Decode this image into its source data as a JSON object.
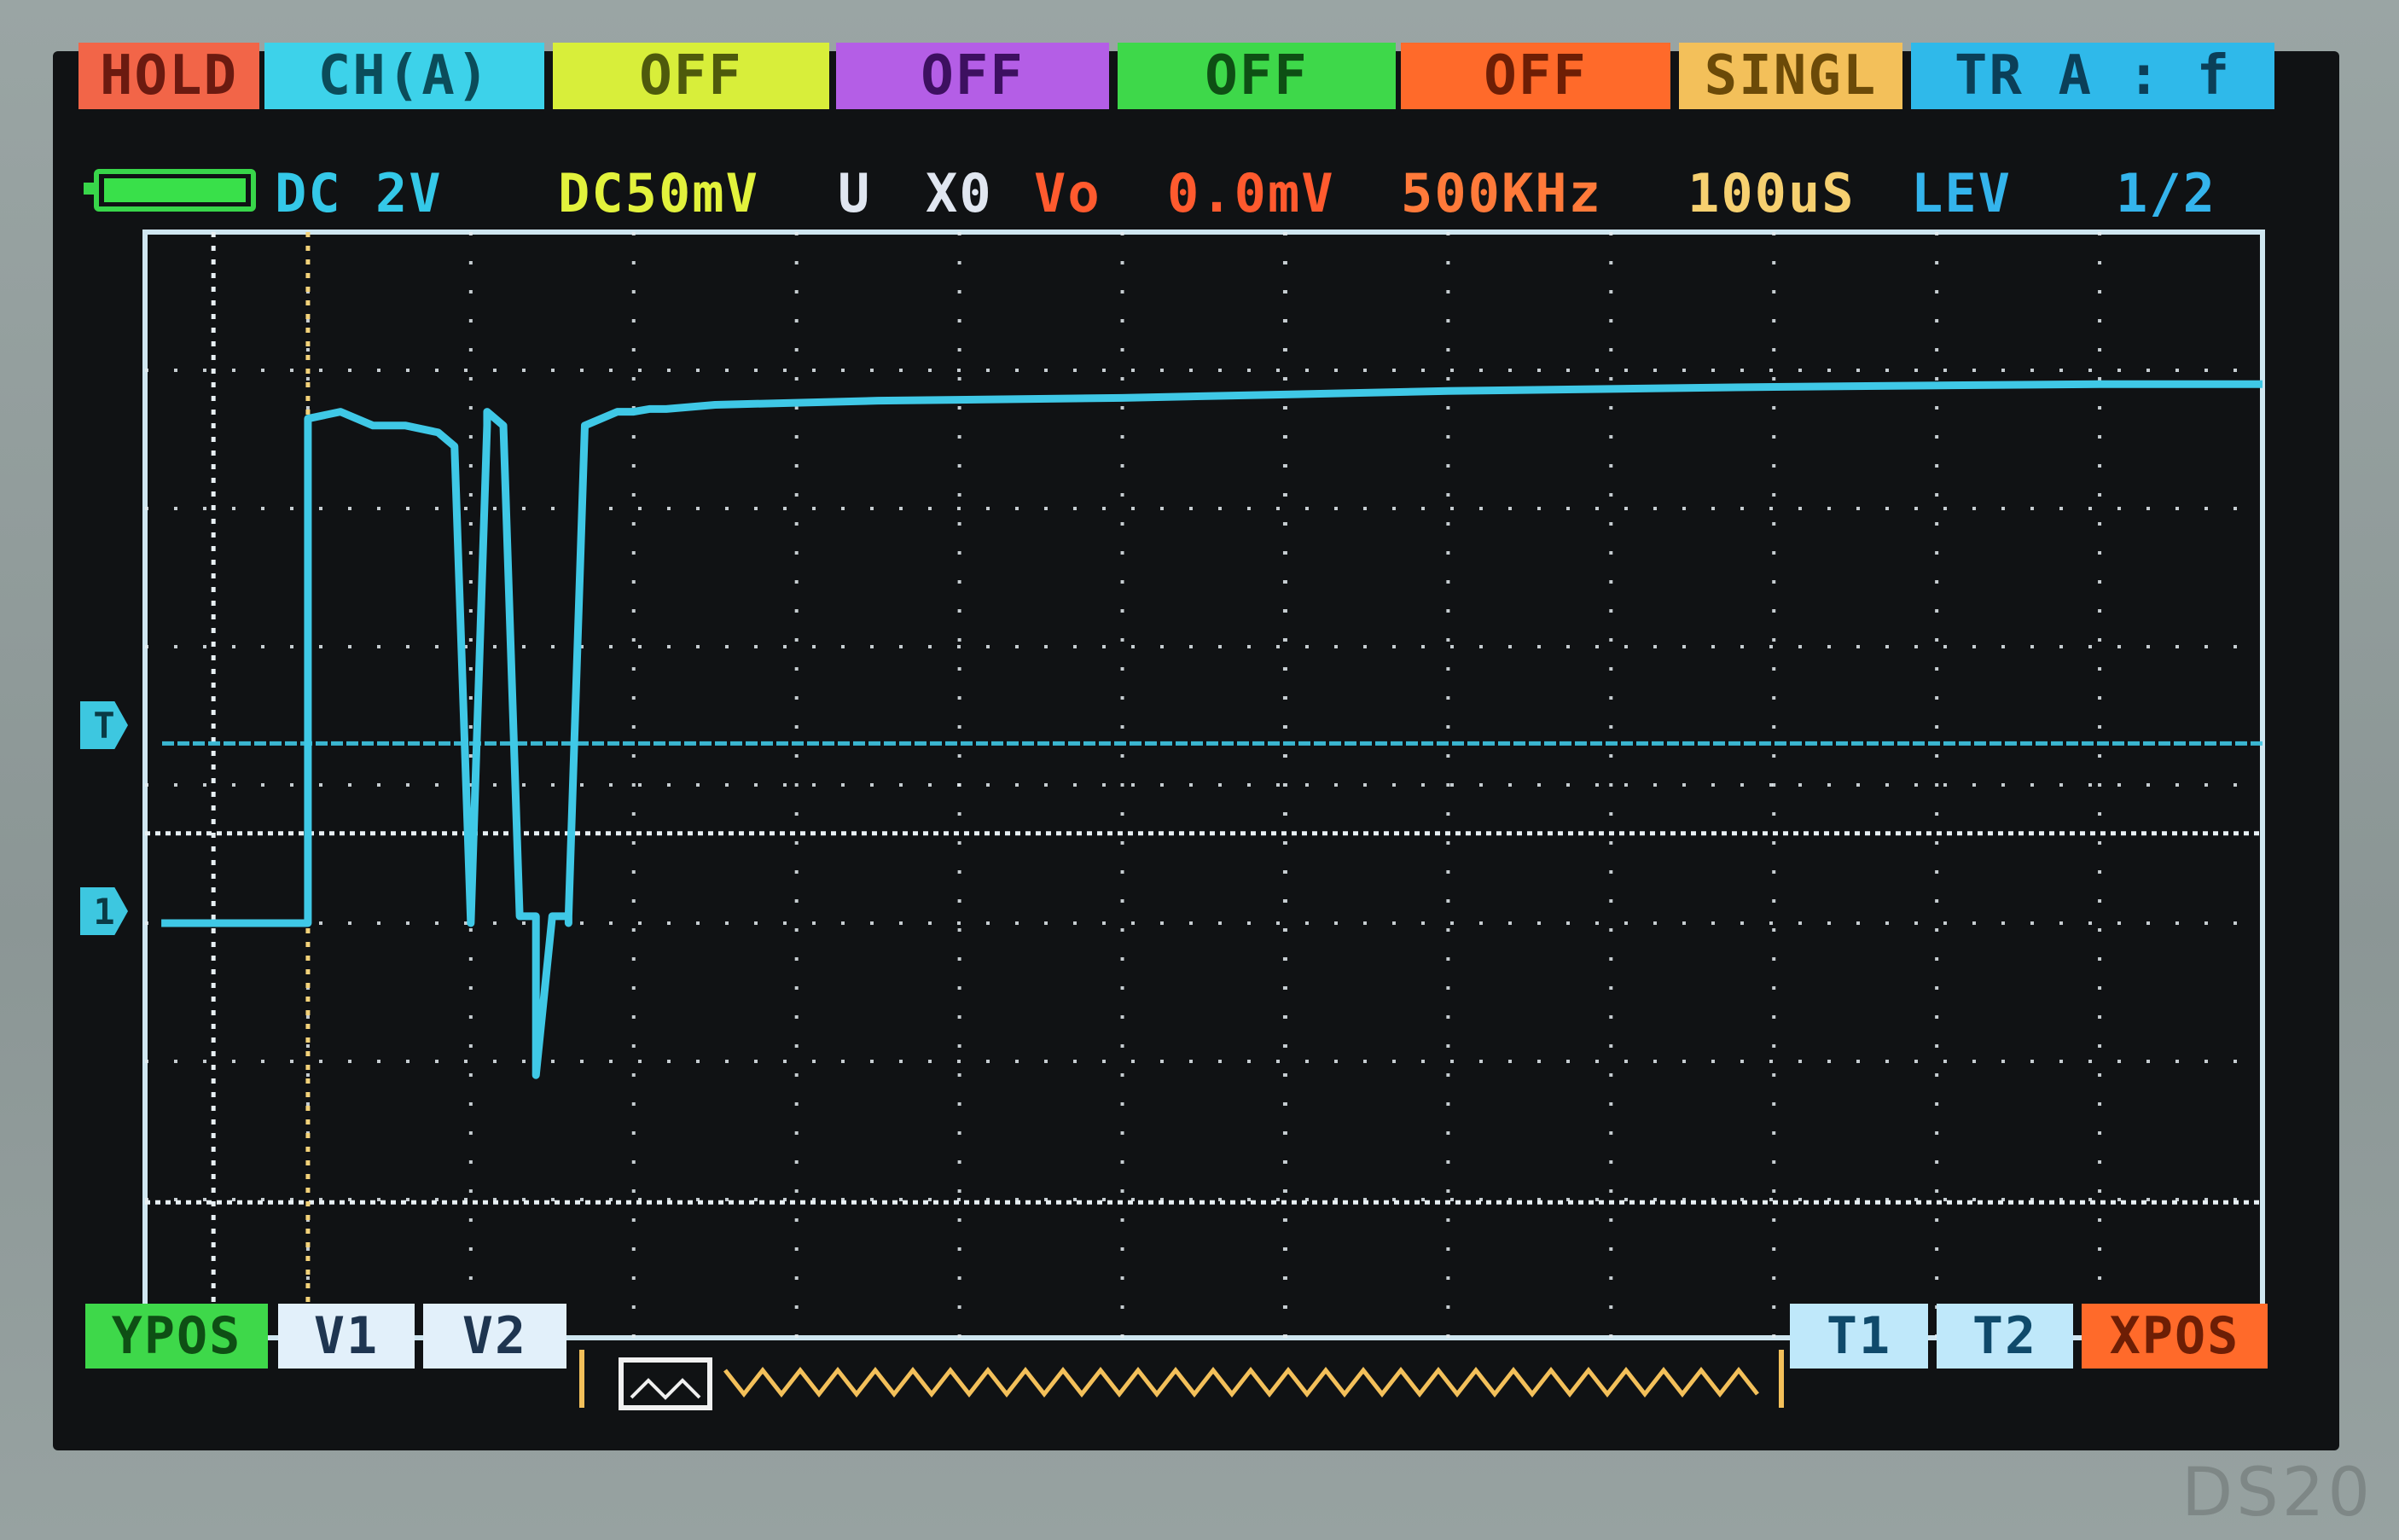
{
  "device_brand": "DS20",
  "header_tabs": [
    {
      "label": "HOLD",
      "bg": "#f26548",
      "fg": "#6b1a10"
    },
    {
      "label": "CH(A)",
      "bg": "#3dd2ea",
      "fg": "#0b4c5a"
    },
    {
      "label": "OFF",
      "bg": "#d8ee3a",
      "fg": "#4e5a0c"
    },
    {
      "label": "OFF",
      "bg": "#b45ee6",
      "fg": "#3d1060"
    },
    {
      "label": "OFF",
      "bg": "#3ed84a",
      "fg": "#0e4f14"
    },
    {
      "label": "OFF",
      "bg": "#ff6a2a",
      "fg": "#6d1e05"
    },
    {
      "label": "SINGL",
      "bg": "#f3c05a",
      "fg": "#6b4a08"
    },
    {
      "label": "TR  A  : f",
      "bg": "#2fb9ea",
      "fg": "#0b3f58"
    }
  ],
  "status_row": [
    {
      "text": "DC 2V",
      "color": "#34c8e8"
    },
    {
      "text": "DC50mV",
      "color": "#e2f23c"
    },
    {
      "text": "U",
      "color": "#e0e6f0"
    },
    {
      "text": "X0",
      "color": "#e0e6f0"
    },
    {
      "text": "Vo",
      "color": "#ff5a2e"
    },
    {
      "text": "0.0mV",
      "color": "#ff5a2e"
    },
    {
      "text": "500KHz",
      "color": "#ff7a3a"
    },
    {
      "text": "100uS",
      "color": "#f6d070"
    },
    {
      "text": "LEV",
      "color": "#34b4ec"
    },
    {
      "text": "1/2",
      "color": "#34b4ec"
    }
  ],
  "bottom_tabs": [
    {
      "label": "YPOS",
      "bg": "#3ed84a",
      "fg": "#0e4f14"
    },
    {
      "label": "V1",
      "bg": "#e2f0fa",
      "fg": "#1e3550"
    },
    {
      "label": "V2",
      "bg": "#e2f0fa",
      "fg": "#1e3550"
    },
    {
      "label": "T1",
      "bg": "#bfe8fa",
      "fg": "#0f4a6b"
    },
    {
      "label": "T2",
      "bg": "#bfe8fa",
      "fg": "#0f4a6b"
    },
    {
      "label": "XPOS",
      "bg": "#ff6a2a",
      "fg": "#6d1e05"
    }
  ],
  "markers": {
    "trigger": "T",
    "channel": "1"
  },
  "icons": {
    "battery": "battery-icon",
    "waveform": "square-wave-icon",
    "timebase_strip": "zigzag-timebase-icon"
  },
  "colors": {
    "trace": "#3fc8e6",
    "grid": "#e6eef2",
    "frame": "#cfe6f0"
  },
  "chart_data": {
    "type": "line",
    "divisions": {
      "x": 13,
      "y": 8
    },
    "time_per_div": "100uS",
    "volts_per_div": "2V",
    "x_range_div": [
      0,
      13
    ],
    "y_range_div": [
      0,
      8
    ],
    "trigger_level_div": 4.3,
    "channel_ground_div": 3.0,
    "series": [
      {
        "x": [
          0.1,
          1.0,
          1.0,
          1.2,
          1.4,
          1.6,
          1.8,
          1.9,
          2.0,
          2.0,
          2.1,
          2.1,
          2.2,
          2.3,
          2.4,
          2.4,
          2.5,
          2.6,
          2.6,
          2.6,
          2.7,
          2.9,
          3.0,
          3.1,
          3.2,
          3.5,
          4.5,
          6.0,
          8.0,
          10.0,
          12.0,
          13.0
        ],
        "y": [
          3.0,
          3.0,
          6.65,
          6.7,
          6.6,
          6.6,
          6.55,
          6.45,
          3.0,
          3.0,
          6.6,
          6.7,
          6.6,
          3.05,
          3.05,
          1.9,
          3.05,
          3.05,
          3.0,
          3.05,
          6.6,
          6.7,
          6.7,
          6.72,
          6.72,
          6.75,
          6.78,
          6.8,
          6.85,
          6.88,
          6.9,
          6.9
        ]
      }
    ]
  }
}
